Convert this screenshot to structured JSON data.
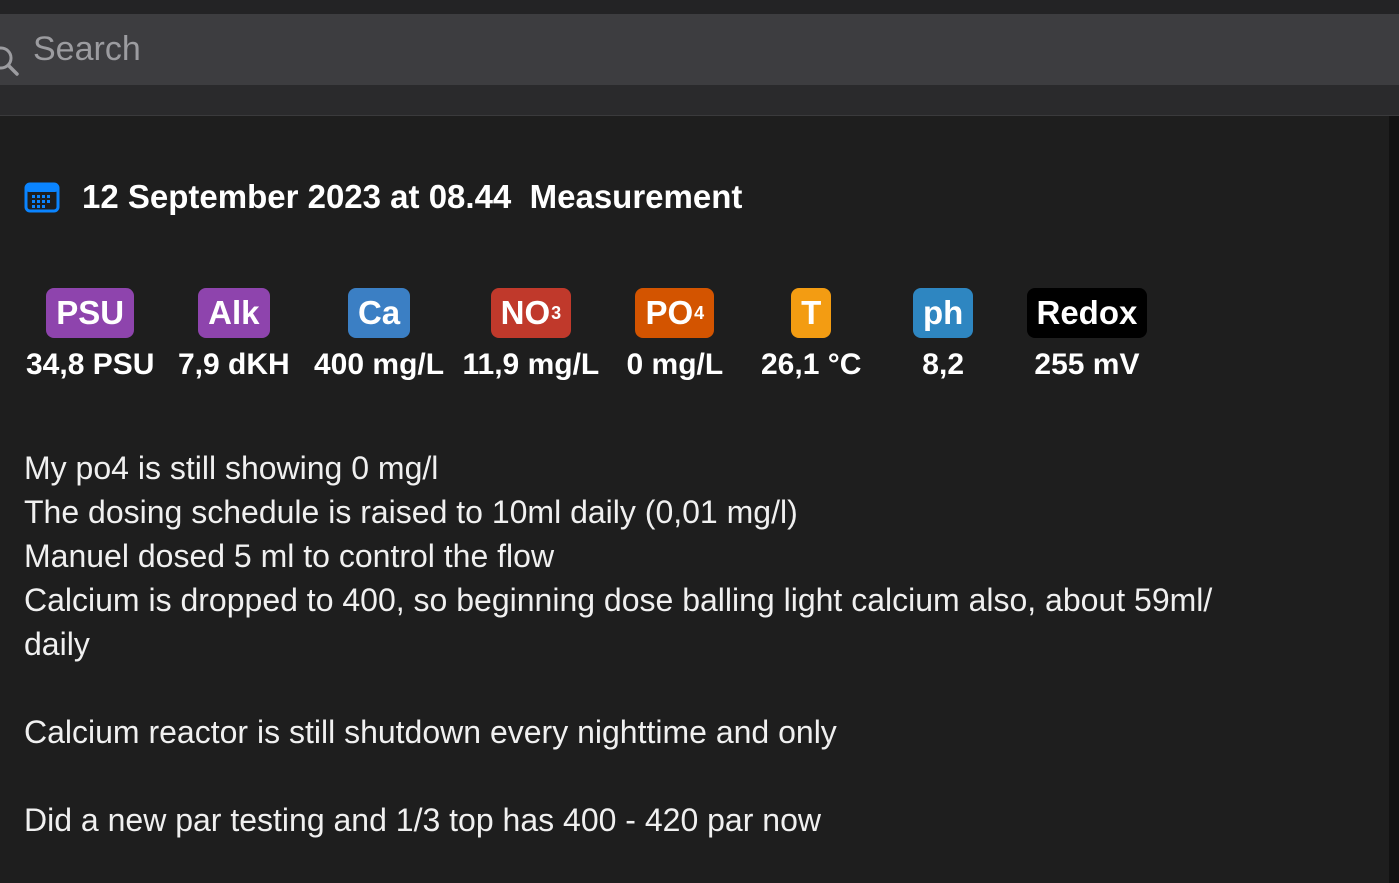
{
  "search": {
    "placeholder": "Search"
  },
  "entry": {
    "date_label": "12 September 2023 at 08.44",
    "title": "Measurement",
    "calendar_icon": "calendar-icon",
    "accent_color": "#0a84ff"
  },
  "parameters": [
    {
      "badge": "PSU",
      "sub": "",
      "value": "34,8 PSU",
      "color": "#8e44ad"
    },
    {
      "badge": "Alk",
      "sub": "",
      "value": "7,9 dKH",
      "color": "#8e44ad"
    },
    {
      "badge": "Ca",
      "sub": "",
      "value": "400 mg/L",
      "color": "#3b7fc4"
    },
    {
      "badge": "NO",
      "sub": "3",
      "value": "11,9 mg/L",
      "color": "#c0392b"
    },
    {
      "badge": "PO",
      "sub": "4",
      "value": "0 mg/L",
      "color": "#d35400"
    },
    {
      "badge": "T",
      "sub": "",
      "value": "26,1 °C",
      "color": "#f39c12"
    },
    {
      "badge": "ph",
      "sub": "",
      "value": "8,2",
      "color": "#2e86c1"
    },
    {
      "badge": "Redox",
      "sub": "",
      "value": "255 mV",
      "color": "#000000"
    }
  ],
  "notes": [
    "My po4 is still showing 0 mg/l",
    "The dosing schedule is raised to 10ml daily (0,01 mg/l)",
    "Manuel dosed 5 ml to control the flow",
    "Calcium is dropped to 400, so beginning dose balling light calcium also, about 59ml/ daily",
    "",
    "Calcium reactor is still shutdown every nighttime and only",
    "",
    "Did a new par testing and 1/3 top has 400 - 420 par now"
  ]
}
